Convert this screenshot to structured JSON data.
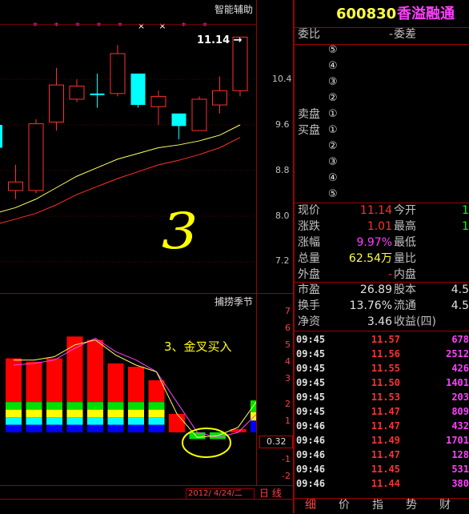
{
  "main_chart": {
    "title": "智能辅助",
    "price_axis": [
      "10.4",
      "9.6",
      "8.8",
      "8.0",
      "7.2"
    ],
    "high_marker": "11.14",
    "annotation": "3",
    "signals": [
      {
        "mark": "*",
        "color": "#ff40ff"
      },
      {
        "mark": "*",
        "color": "#ff40ff"
      },
      {
        "mark": "*",
        "color": "#ff40ff"
      },
      {
        "mark": "*",
        "color": "#ff40ff"
      },
      {
        "mark": "*",
        "color": "#ff40ff"
      },
      {
        "mark": "×",
        "color": "#ffffff"
      },
      {
        "mark": "×",
        "color": "#ffffff"
      },
      {
        "mark": "*",
        "color": "#ff40ff"
      },
      {
        "mark": "*",
        "color": "#ff40ff"
      }
    ],
    "candles": [
      {
        "o": 9.2,
        "h": 9.6,
        "l": 8.6,
        "c": 9.6,
        "color": "cyan"
      },
      {
        "o": 8.6,
        "h": 8.9,
        "l": 8.3,
        "c": 8.45,
        "color": "red"
      },
      {
        "o": 8.45,
        "h": 9.7,
        "l": 8.4,
        "c": 9.62,
        "color": "red"
      },
      {
        "o": 9.65,
        "h": 10.6,
        "l": 9.5,
        "c": 10.3,
        "color": "red"
      },
      {
        "o": 10.05,
        "h": 10.4,
        "l": 10.0,
        "c": 10.28,
        "color": "red"
      },
      {
        "o": 10.15,
        "h": 10.5,
        "l": 9.9,
        "c": 10.15,
        "color": "cyan"
      },
      {
        "o": 10.15,
        "h": 11.0,
        "l": 10.1,
        "c": 10.85,
        "color": "red"
      },
      {
        "o": 10.5,
        "h": 10.5,
        "l": 9.9,
        "c": 9.95,
        "color": "cyan"
      },
      {
        "o": 9.92,
        "h": 10.2,
        "l": 9.6,
        "c": 10.1,
        "color": "red"
      },
      {
        "o": 9.8,
        "h": 9.8,
        "l": 9.35,
        "c": 9.58,
        "color": "cyan"
      },
      {
        "o": 9.5,
        "h": 10.1,
        "l": 9.5,
        "c": 10.05,
        "color": "red"
      },
      {
        "o": 9.95,
        "h": 10.45,
        "l": 9.8,
        "c": 10.2,
        "color": "red"
      },
      {
        "o": 10.2,
        "h": 11.14,
        "l": 10.1,
        "c": 11.14,
        "color": "red"
      }
    ],
    "ma_short": [
      8.05,
      8.15,
      8.3,
      8.5,
      8.7,
      8.85,
      9.0,
      9.1,
      9.2,
      9.25,
      9.32,
      9.42,
      9.6
    ],
    "ma_long": [
      7.85,
      7.95,
      8.05,
      8.2,
      8.38,
      8.52,
      8.66,
      8.78,
      8.9,
      8.98,
      9.08,
      9.2,
      9.38
    ]
  },
  "sub_chart": {
    "title": "捕捞季节",
    "axis": [
      "7",
      "6",
      "5",
      "4",
      "3",
      "2",
      "1",
      "0",
      "-1",
      "-2"
    ],
    "current_value": "0.32",
    "annotation": "3、金叉买入",
    "bars": [
      4.4,
      4.2,
      4.4,
      5.7,
      5.5,
      4.1,
      3.9,
      3.1,
      1.1,
      -0.4,
      -0.4,
      0.2,
      1.2
    ],
    "line_a": [
      4.3,
      4.3,
      4.5,
      5.2,
      5.5,
      4.6,
      4.0,
      3.6,
      1.1,
      -0.3,
      -0.2,
      0.3,
      2.0
    ],
    "line_b": [
      4.0,
      4.1,
      4.3,
      5.0,
      5.6,
      4.8,
      4.3,
      3.6,
      1.8,
      0.0,
      -0.3,
      0.0,
      1.2
    ]
  },
  "date_bar": {
    "date": "2012/ 4/24/二",
    "period": "日 线"
  },
  "quote": {
    "code": "600830",
    "name": "香溢融通",
    "weibi_label": "委比",
    "weicha_label": "委差",
    "weicha_value": "-",
    "sell_label": "卖盘",
    "buy_label": "买盘",
    "levels": [
      "⑤",
      "④",
      "③",
      "②",
      "①",
      "①",
      "②",
      "③",
      "④",
      "⑤"
    ],
    "rows1": [
      {
        "l1": "现价",
        "v1": "11.14",
        "l2": "今开",
        "v2": "1"
      },
      {
        "l1": "涨跌",
        "v1": "1.01",
        "l2": "最高",
        "v2": "1"
      },
      {
        "l1": "涨幅",
        "v1": "9.97%",
        "l2": "最低",
        "v2": ""
      },
      {
        "l1": "总量",
        "v1": "62.54万",
        "l2": "量比",
        "v2": ""
      },
      {
        "l1": "外盘",
        "v1": "-",
        "l2": "内盘",
        "v2": ""
      }
    ],
    "rows2": [
      {
        "l1": "市盈",
        "v1": "26.89",
        "l2": "股本",
        "v2": "4.5"
      },
      {
        "l1": "换手",
        "v1": "13.76%",
        "l2": "流通",
        "v2": "4.5"
      },
      {
        "l1": "净资",
        "v1": "3.46",
        "l2": "收益(四)",
        "v2": ""
      }
    ],
    "ticks": [
      {
        "t": "09:45",
        "p": "11.57",
        "v": "678"
      },
      {
        "t": "09:45",
        "p": "11.56",
        "v": "2512"
      },
      {
        "t": "09:45",
        "p": "11.55",
        "v": "426"
      },
      {
        "t": "09:45",
        "p": "11.50",
        "v": "1401"
      },
      {
        "t": "09:45",
        "p": "11.53",
        "v": "203"
      },
      {
        "t": "09:45",
        "p": "11.47",
        "v": "809"
      },
      {
        "t": "09:46",
        "p": "11.47",
        "v": "432"
      },
      {
        "t": "09:46",
        "p": "11.49",
        "v": "1701"
      },
      {
        "t": "09:46",
        "p": "11.47",
        "v": "128"
      },
      {
        "t": "09:46",
        "p": "11.45",
        "v": "531"
      },
      {
        "t": "09:46",
        "p": "11.44",
        "v": "380"
      }
    ],
    "tabs": [
      "细",
      "价",
      "指",
      "势",
      "财"
    ]
  }
}
